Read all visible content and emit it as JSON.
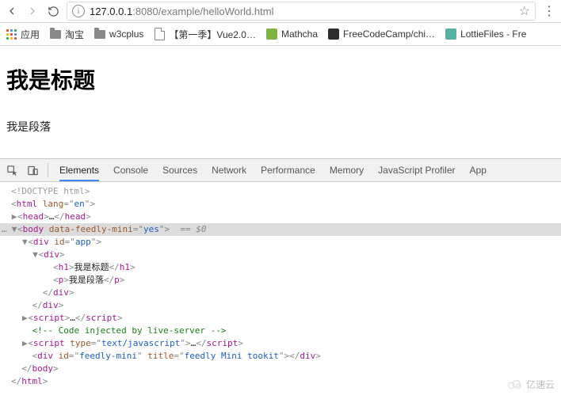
{
  "browser": {
    "url_host": "127.0.0.1",
    "url_rest": ":8080/example/helloWorld.html"
  },
  "bookmarks": {
    "apps": "应用",
    "taobao": "淘宝",
    "w3cplus": "w3cplus",
    "vue": "【第一季】Vue2.0…",
    "mathcha": "Mathcha",
    "fcc": "FreeCodeCamp/chi…",
    "lottie": "LottieFiles - Fre"
  },
  "page": {
    "h1": "我是标题",
    "p": "我是段落"
  },
  "devtools": {
    "tabs": {
      "elements": "Elements",
      "console": "Console",
      "sources": "Sources",
      "network": "Network",
      "performance": "Performance",
      "memory": "Memory",
      "jsprofiler": "JavaScript Profiler",
      "app": "App"
    },
    "dom": {
      "doctype": "<!DOCTYPE html>",
      "html_open_tag": "html",
      "html_lang_attr": "lang",
      "html_lang_val": "en",
      "head_tag": "head",
      "head_ellipsis": "…",
      "body_tag": "body",
      "body_attr": "data-feedly-mini",
      "body_val": "yes",
      "eq0": "== $0",
      "div_tag": "div",
      "id_attr": "id",
      "app_val": "app",
      "h1_tag": "h1",
      "h1_text": "我是标题",
      "p_tag": "p",
      "p_text": "我是段落",
      "script_tag": "script",
      "script_ellipsis": "…",
      "comment": " Code injected by live-server ",
      "type_attr": "type",
      "type_val": "text/javascript",
      "feedly_val": "feedly-mini",
      "title_attr": "title",
      "title_val": "feedly Mini tookit"
    }
  },
  "watermark": "亿速云"
}
